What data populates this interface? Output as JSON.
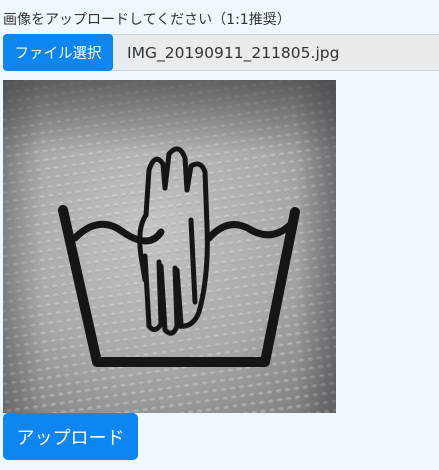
{
  "upload_form": {
    "instruction": "画像をアップロードしてください（1:1推奨）",
    "file_select_label": "ファイル選択",
    "file_name": "IMG_20190911_211805.jpg",
    "upload_label": "アップロード"
  },
  "colors": {
    "primary": "#0d86f2",
    "background": "#eef8fd"
  }
}
